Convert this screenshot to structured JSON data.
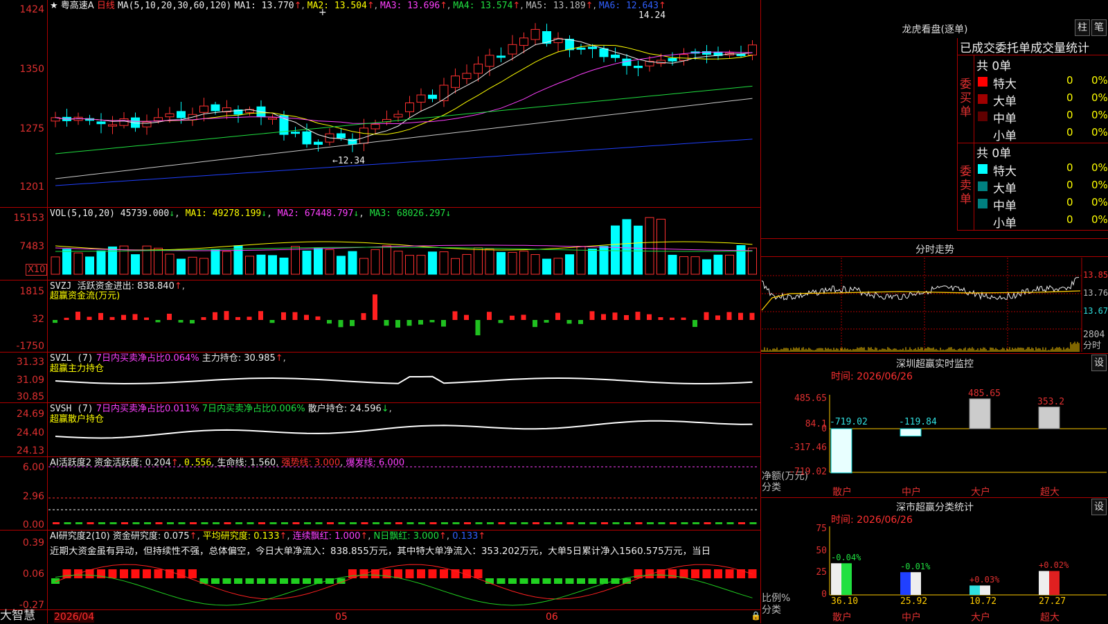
{
  "stock": {
    "name": "粤高速A",
    "period": "日线"
  },
  "main": {
    "ma_label": "MA(5,10,20,30,60,120)",
    "ma1": "MA1: 13.770",
    "ma2": "MA2: 13.504",
    "ma3": "MA3: 13.696",
    "ma4": "MA4: 13.574",
    "ma5": "MA5: 13.189",
    "ma6": "MA6: 12.643",
    "hi_label": "14.24",
    "lo_label": "12.34",
    "axis": [
      "1424",
      "1350",
      "1275",
      "1201"
    ]
  },
  "vol": {
    "label": "VOL(5,10,20)",
    "value": "45739.000",
    "ma1": "MA1: 49278.199",
    "ma2": "MA2: 67448.797",
    "ma3": "MA3: 68026.297",
    "axis": [
      "15153",
      "7483"
    ],
    "unit": "X10"
  },
  "svzj": {
    "label": "SVZJ",
    "name": "活跃资金进出: 838.840",
    "sub": "超赢资金流(万元)",
    "axis": [
      "1815",
      "32",
      "-1750"
    ]
  },
  "svzl": {
    "label": "SVZL (7)",
    "t1": "7日内买卖净占比0.064%",
    "t2": "主力持仓: 30.985",
    "sub": "超赢主力持仓",
    "axis": [
      "31.33",
      "31.09",
      "30.85"
    ]
  },
  "svsh": {
    "label": "SVSH (7)",
    "t1": "7日内买卖净占比0.011%",
    "t2": "7日内买卖净占比0.006%",
    "t3": "散户持仓: 24.596",
    "sub": "超赢散户持仓",
    "axis": [
      "24.69",
      "24.40",
      "24.13"
    ]
  },
  "ai1": {
    "label": "AI活跃度2",
    "t1": "资金活跃度: 0.204",
    "t2": "0.556",
    "t3": "生命线: 1.560",
    "t4": "强势线: 3.000",
    "t5": "爆发线: 6.000",
    "axis": [
      "6.00",
      "2.96",
      "0.00"
    ]
  },
  "ai2": {
    "label": "AI研究度2(10)",
    "t1": "资金研究度: 0.075",
    "t2": "平均研究度: 0.133",
    "t3": "连续飘红: 1.000",
    "t4": "N日飘红: 3.000",
    "t5": "0.133",
    "comment": "近期大资金虽有异动，但持续性不强，总体偏空，今日大单净流入：838.855万元，其中特大单净流入：353.202万元，大单5日累计净入1560.575万元，当日",
    "axis": [
      "0.39",
      "0.06",
      "-0.27"
    ]
  },
  "date_axis": [
    "2026/04",
    "05",
    "06"
  ],
  "brand": "大智慧",
  "longhu": {
    "title": "龙虎看盘(逐单)",
    "btn1": "柱",
    "btn2": "笔",
    "header": "已成交委托单成交量统计",
    "buy_label": "委买单",
    "sell_label": "委卖单",
    "buy_total": "共 0单",
    "sell_total": "共 0单",
    "buy_rows": [
      {
        "name": "特大",
        "n": "0",
        "p": "0%",
        "color": "#ff0000"
      },
      {
        "name": "大单",
        "n": "0",
        "p": "0%",
        "color": "#a00000"
      },
      {
        "name": "中单",
        "n": "0",
        "p": "0%",
        "color": "#600000"
      },
      {
        "name": "小单",
        "n": "0",
        "p": "0%",
        "color": "#000000"
      }
    ],
    "sell_rows": [
      {
        "name": "特大",
        "n": "0",
        "p": "0%",
        "color": "#00ffff"
      },
      {
        "name": "大单",
        "n": "0",
        "p": "0%",
        "color": "#008080"
      },
      {
        "name": "中单",
        "n": "0",
        "p": "0%",
        "color": "#008080"
      },
      {
        "name": "小单",
        "n": "0",
        "p": "0%",
        "color": "#000000"
      }
    ]
  },
  "fenshi": {
    "title": "分时走势",
    "axis": [
      "13.85",
      "13.76",
      "13.67"
    ],
    "vol_axis": "2804",
    "vol_unit": "分时"
  },
  "monitor": {
    "title": "深圳超赢实时监控",
    "btn": "设",
    "time": "时间: 2026/06/26",
    "axis": [
      "485.65",
      "84.1",
      "0",
      "-317.46",
      "-719.02"
    ],
    "ylabel1": "净额(万元)",
    "ylabel2": "分类",
    "bars": [
      {
        "cat": "散户",
        "value": -719.02,
        "label": "-719.02"
      },
      {
        "cat": "中户",
        "value": -119.84,
        "label": "-119.84"
      },
      {
        "cat": "大户",
        "value": 485.65,
        "label": "485.65"
      },
      {
        "cat": "超大",
        "value": 353.2,
        "label": "353.2"
      }
    ]
  },
  "classify": {
    "title": "深市超赢分类统计",
    "btn": "设",
    "time": "时间: 2026/06/26",
    "axis": [
      "75",
      "50",
      "25",
      "0"
    ],
    "ylabel1": "比例%",
    "ylabel2": "分类",
    "bars": [
      {
        "cat": "散户",
        "value": 36.1,
        "label": "36.10",
        "delta": "-0.04%"
      },
      {
        "cat": "中户",
        "value": 25.92,
        "label": "25.92",
        "delta": "-0.01%"
      },
      {
        "cat": "大户",
        "value": 10.72,
        "label": "10.72",
        "delta": "+0.03%"
      },
      {
        "cat": "超大",
        "value": 27.27,
        "label": "27.27",
        "delta": "+0.02%"
      }
    ]
  }
}
